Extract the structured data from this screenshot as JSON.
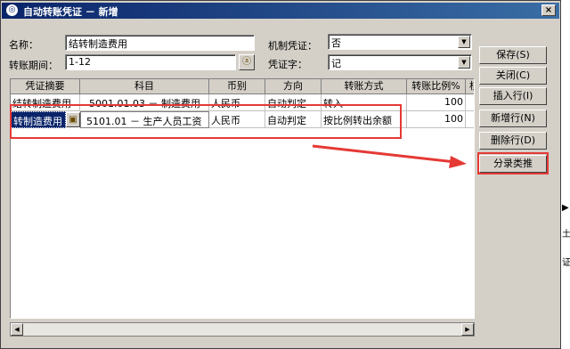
{
  "window": {
    "title": "自动转账凭证 － 新增",
    "close": "×"
  },
  "form": {
    "name_label": "名称：",
    "name_value": "结转制造费用",
    "period_label": "转账期间：",
    "period_value": "1-12",
    "auto_voucher_label": "机制凭证：",
    "auto_voucher_value": "否",
    "voucher_word_label": "凭证字：",
    "voucher_word_value": "记"
  },
  "buttons": {
    "save": "保存(S)",
    "close": "关闭(C)",
    "insert_row": "插入行(I)",
    "add_row": "新增行(N)",
    "delete_row": "删除行(D)",
    "entry_analogy": "分录类推"
  },
  "table": {
    "headers": [
      "凭证摘要",
      "科目",
      "币别",
      "方向",
      "转账方式",
      "转账比例%",
      "核"
    ],
    "rows": [
      [
        "结转制造费用",
        "5001.01.03 － 制造费用",
        "人民币",
        "自动判定",
        "转入",
        "100",
        ""
      ],
      [
        "转制造费用",
        "5101.01 － 生产人员工资",
        "人民币",
        "自动判定",
        "按比例转出余额",
        "100",
        ""
      ]
    ]
  },
  "icons": {
    "lookup": "ⓐ",
    "dropdown": "▼",
    "left": "◀",
    "right": "▶",
    "folder": "▣"
  },
  "peek": {
    "p1": "▶",
    "p2": "土",
    "p3": "证"
  },
  "colors": {
    "titlebar": "#0a246a",
    "highlight": "#e53935",
    "selection": "#0a246a"
  }
}
